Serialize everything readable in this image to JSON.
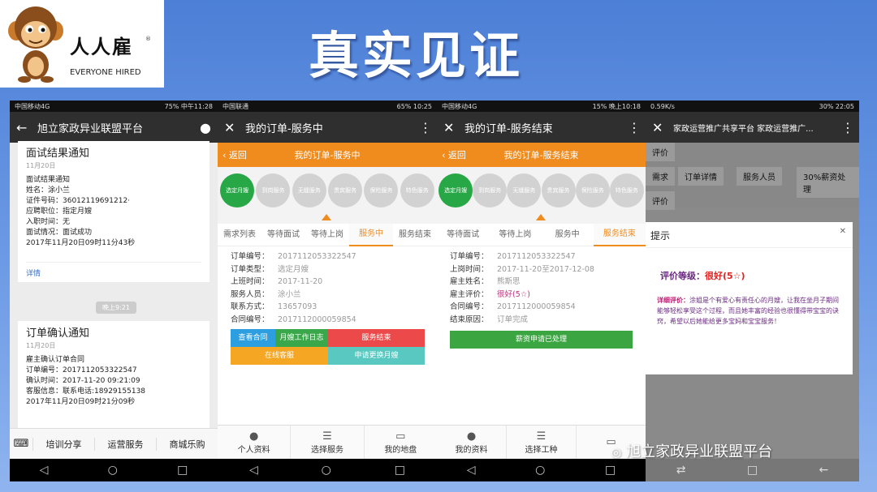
{
  "header": {
    "brand_cn": "人人雇",
    "brand_reg": "®",
    "brand_en": "EVERYONE HIRED",
    "headline": "真实见证"
  },
  "phone1": {
    "status_left": "中国移动4G",
    "status_right": "75% 中午11:28",
    "title": "旭立家政异业联盟平台",
    "card1": {
      "title": "面试结果通知",
      "date": "11月20日",
      "lines": [
        "面试结果通知",
        "姓名：涂小兰",
        "证件号码：36012119691212·",
        "应聘职位：指定月嫂",
        "入职时间：无",
        "面试情况：面试成功",
        "2017年11月20日09时11分43秒"
      ],
      "link": "详情"
    },
    "pill": "晚上9:21",
    "card2": {
      "title": "订单确认通知",
      "date": "11月20日",
      "lines": [
        "雇主确认订单合同",
        "订单编号：2017112053322547",
        "确认时间：2017-11-20 09:21:09",
        "客服信息：联系电话:18929155138",
        "2017年11月20日09时21分09秒"
      ]
    },
    "menu": [
      "培训分享",
      "运营服务",
      "商城乐购"
    ]
  },
  "phone2": {
    "status_left": "中国联通",
    "status_right": "65% 10:25",
    "title": "我的订单-服务中",
    "back": "返回",
    "orange_title": "我的订单-服务中",
    "steps": [
      "选定月嫂",
      "到岗服务",
      "无缝服务",
      "贵宾服务",
      "保险服务",
      "特色服务"
    ],
    "tabs": [
      "需求列表",
      "等待面试",
      "等待上岗",
      "服务中",
      "服务结束"
    ],
    "fields": [
      {
        "k": "订单编号：",
        "v": "2017112053322547"
      },
      {
        "k": "订单类型：",
        "v": "选定月嫂"
      },
      {
        "k": "上班时间：",
        "v": "2017-11-20"
      },
      {
        "k": "服务人员：",
        "v": "涂小兰"
      },
      {
        "k": "联系方式：",
        "v": "13657093"
      },
      {
        "k": "合同编号：",
        "v": "2017112000059854"
      }
    ],
    "buttons": {
      "view": "查看合同",
      "log": "月嫂工作日志",
      "end": "服务结束",
      "cs": "在线客服",
      "change": "申请更换月嫂"
    },
    "bottom": [
      "个人资料",
      "选择服务",
      "我的地盘"
    ]
  },
  "phone3": {
    "status_left": "中国移动4G",
    "status_right": "15% 晚上10:18",
    "title": "我的订单-服务结束",
    "back": "返回",
    "orange_title": "我的订单-服务结束",
    "steps": [
      "选定月嫂",
      "到岗服务",
      "无缝服务",
      "贵宾服务",
      "保险服务",
      "特色服务"
    ],
    "tabs": [
      "等待面试",
      "等待上岗",
      "服务中",
      "服务结束"
    ],
    "fields": [
      {
        "k": "订单编号：",
        "v": "2017112053322547"
      },
      {
        "k": "上岗时间：",
        "v": "2017-11-20至2017-12-08"
      },
      {
        "k": "雇主姓名：",
        "v": "熊斯思"
      },
      {
        "k": "雇主评价：",
        "v": "很好(5☆)"
      },
      {
        "k": "合同编号：",
        "v": "2017112000059854"
      },
      {
        "k": "结束原因：",
        "v": "订单完成"
      }
    ],
    "green_button": "薪资申请已处理",
    "bottom": [
      "我的资料",
      "选择工种",
      ""
    ]
  },
  "phone4": {
    "status_left": "0.59K/s",
    "status_right": "30% 22:05",
    "title": "家政运营推广共享平台 家政运营推广...",
    "grid": [
      "评价",
      "需求",
      "订单详情",
      "服务人员",
      "30%薪资处理",
      "评价"
    ],
    "modal_title": "提示",
    "rating_label": "评价等级：",
    "rating_value": "很好(5☆)",
    "detail_label": "详细评价：",
    "detail_text": "涂姐是个有爱心有责任心的月嫂，让我在坐月子期间能够轻松享受这个过程，而且她丰富的经验也很懂得带宝宝的诀窍，希望以后她能给更多宝妈和宝宝服务！"
  },
  "watermark": "旭立家政异业联盟平台"
}
